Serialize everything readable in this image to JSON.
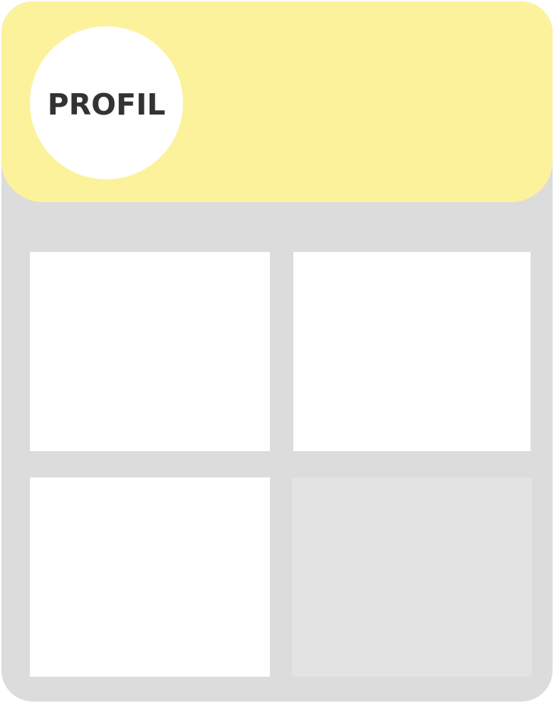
{
  "profile": {
    "label": "PROFIL"
  },
  "colors": {
    "header_background": "#fdf29c",
    "card_background": "#dcdcdc",
    "avatar_background": "#ffffff",
    "label_text": "#333333",
    "tile_filled": "#ffffff",
    "tile_empty": "#e3e3e3"
  },
  "tiles": [
    {
      "state": "filled"
    },
    {
      "state": "filled"
    },
    {
      "state": "filled"
    },
    {
      "state": "empty"
    }
  ]
}
